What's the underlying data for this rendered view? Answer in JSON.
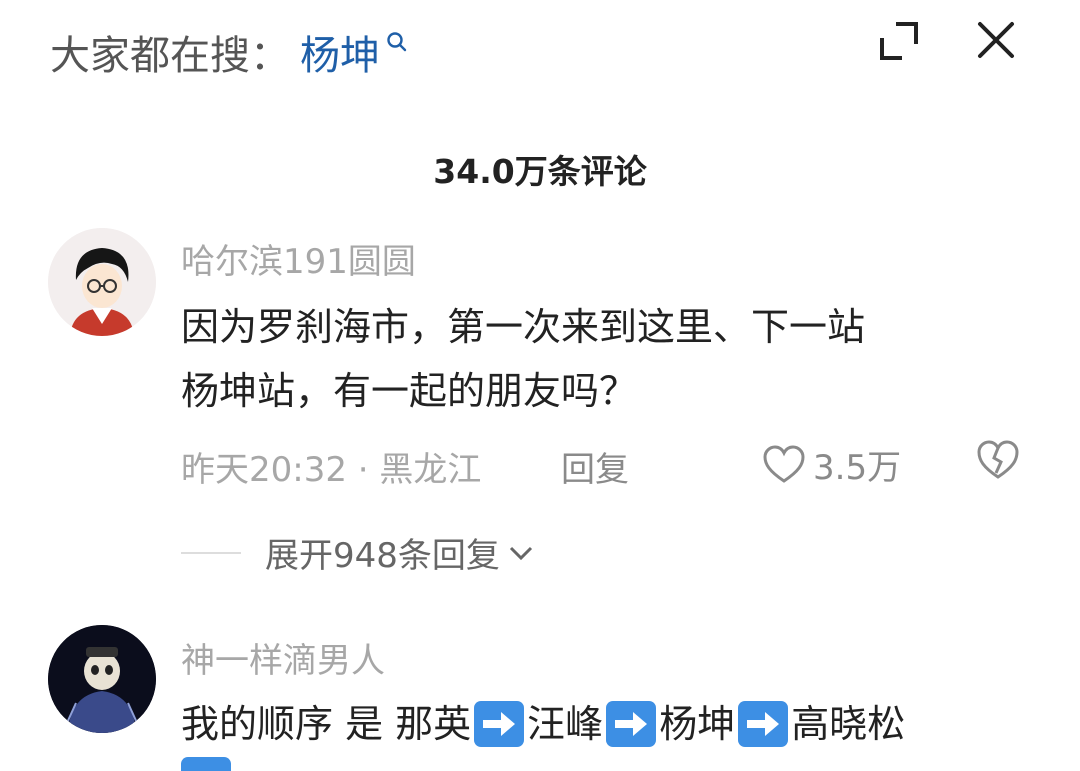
{
  "header": {
    "search_prefix": "大家都在搜：",
    "search_keyword": "杨坤"
  },
  "comments_header": {
    "count_label": "34.0万条评论"
  },
  "comments": [
    {
      "username": "哈尔滨191圆圆",
      "text_line1": "因为罗刹海市，第一次来到这里、下一站",
      "text_line2": "杨坤站，有一起的朋友吗？",
      "time_location": "昨天20:32 · 黑龙江",
      "reply_label": "回复",
      "likes": "3.5万",
      "expand_replies": "展开948条回复"
    },
    {
      "username": "神一样滴男人",
      "segments": [
        "我的顺序 是 那英",
        "汪峰",
        "杨坤",
        "高晓松"
      ]
    }
  ],
  "colors": {
    "link_blue": "#1f5fa8",
    "muted_gray": "#a7a7a7",
    "emoji_blue": "#3d8fe4"
  },
  "icons": [
    "search-icon",
    "expand-icon",
    "close-icon",
    "heart-icon",
    "broken-heart-icon",
    "chevron-down-icon",
    "arrow-right-emoji"
  ]
}
